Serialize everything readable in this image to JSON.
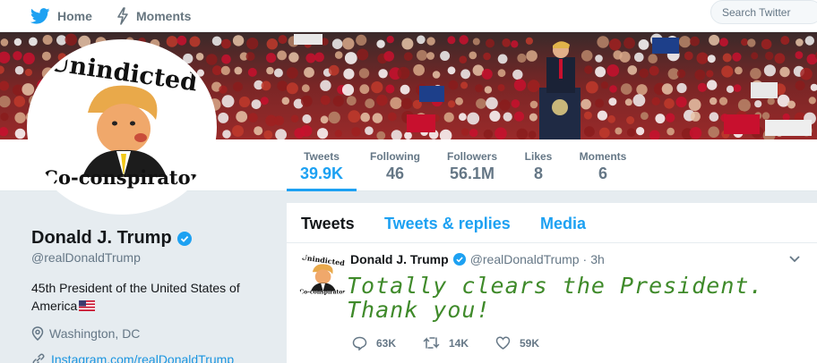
{
  "nav": {
    "home_label": "Home",
    "moments_label": "Moments",
    "search_placeholder": "Search Twitter"
  },
  "avatar": {
    "top_text": "Unindicted",
    "bottom_text": "Co-conspirator"
  },
  "stats": [
    {
      "label": "Tweets",
      "value": "39.9K",
      "active": true
    },
    {
      "label": "Following",
      "value": "46"
    },
    {
      "label": "Followers",
      "value": "56.1M"
    },
    {
      "label": "Likes",
      "value": "8"
    },
    {
      "label": "Moments",
      "value": "6"
    }
  ],
  "profile": {
    "name": "Donald J. Trump",
    "handle": "@realDonaldTrump",
    "bio": "45th President of the United States of America",
    "location": "Washington, DC",
    "link": "Instagram.com/realDonaldTrump"
  },
  "timeline": {
    "tabs": [
      "Tweets",
      "Tweets & replies",
      "Media"
    ],
    "tweet": {
      "name": "Donald J. Trump",
      "handle": "@realDonaldTrump",
      "dot": "·",
      "time": "3h",
      "text": "Totally clears the President. Thank you!",
      "replies": "63K",
      "retweets": "14K",
      "likes": "59K"
    }
  },
  "colors": {
    "accent": "#1da1f2",
    "handwriting": "#3f8a2a",
    "background": "#e6ecf0"
  }
}
